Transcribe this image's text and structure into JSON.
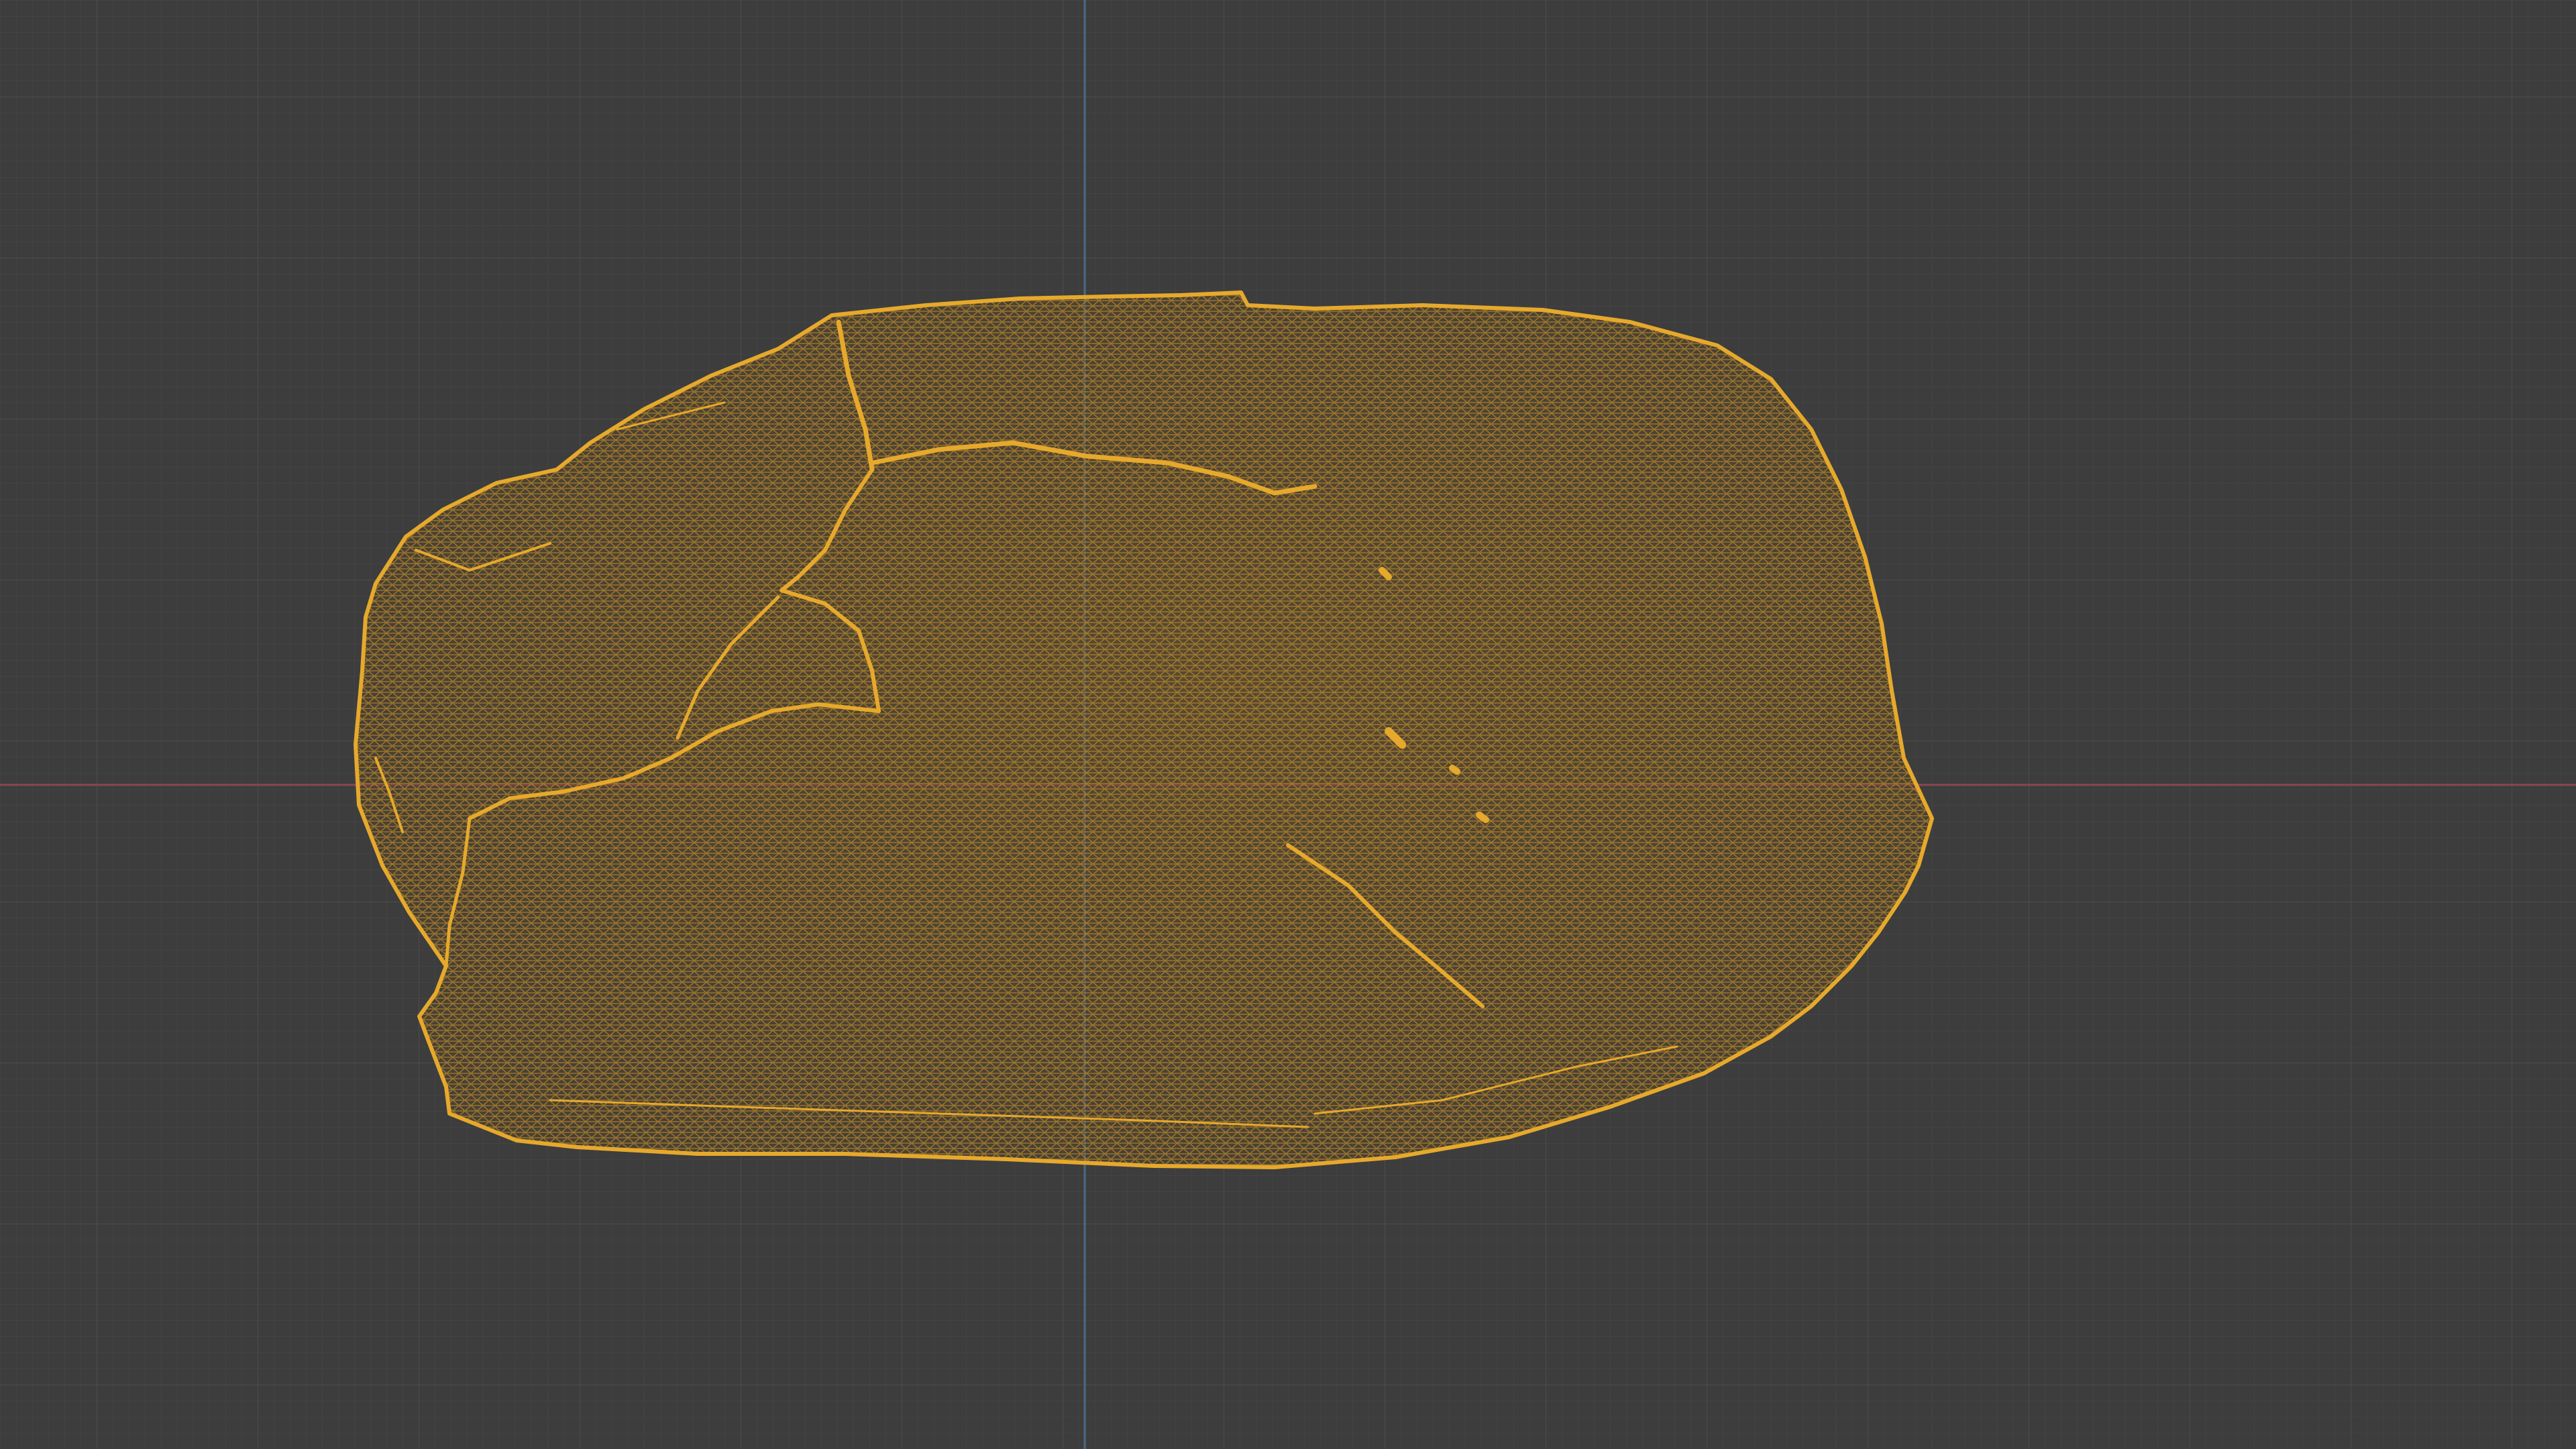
{
  "viewport": {
    "view": "orthographic",
    "shading": "wireframe",
    "grid": true,
    "axes_shown": [
      "x",
      "y"
    ],
    "colors": {
      "background": "#3d3d3d",
      "grid_minor": "#454545",
      "grid_major": "#4c4c4c",
      "x_axis": "#8a4650",
      "y_axis": "#4a6a8a",
      "selection_wire": "#e0a32a"
    }
  },
  "object": {
    "kind": "scanned-rock-mesh",
    "selected": true,
    "display": "wireframe"
  }
}
